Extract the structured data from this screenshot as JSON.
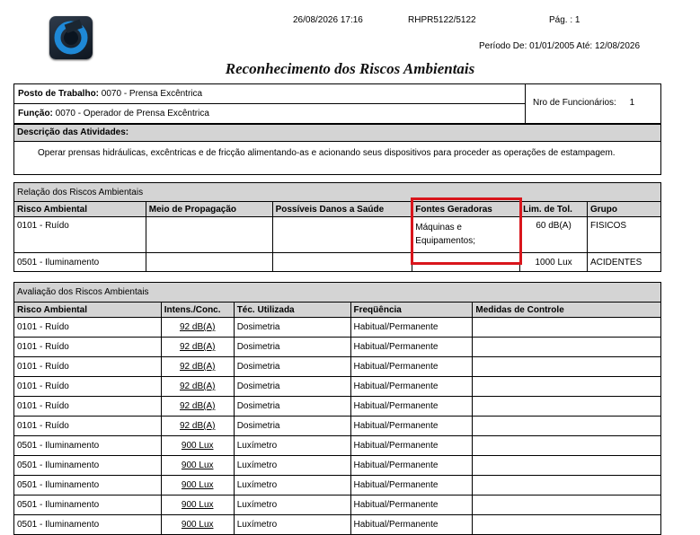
{
  "header": {
    "datetime": "26/08/2026 17:16",
    "report_code": "RHPR5122/5122",
    "page": "Pág. : 1",
    "period": "Período De: 01/01/2005 Até: 12/08/2026"
  },
  "title": "Reconhecimento dos Riscos Ambientais",
  "posto_label": "Posto de Trabalho:",
  "posto_value": "0070 - Prensa Excêntrica",
  "funcao_label": "Função:",
  "funcao_value": "0070 - Operador de Prensa Excêntrica",
  "nro_func_label": "Nro de Funcionários:",
  "nro_func_value": "1",
  "atividades_label": "Descrição das Atividades:",
  "atividades_text": "Operar prensas hidráulicas, excêntricas e de fricção alimentando-as e acionando seus dispositivos para proceder as operações de estampagem.",
  "relacao": {
    "section_title": "Relação dos Riscos Ambientais",
    "columns": [
      "Risco Ambiental",
      "Meio de Propagação",
      "Possíveis Danos a Saúde",
      "Fontes Geradoras",
      "Lim. de Tol.",
      "Grupo"
    ],
    "rows": [
      {
        "risco": "0101 - Ruído",
        "meio": "",
        "danos": "",
        "fontes": "Máquinas e Equipamentos;",
        "lim": "60 dB(A)",
        "grupo": "FISICOS"
      },
      {
        "risco": "0501 - Iluminamento",
        "meio": "",
        "danos": "",
        "fontes": "",
        "lim": "1000 Lux",
        "grupo": "ACIDENTES"
      }
    ]
  },
  "avaliacao": {
    "section_title": "Avaliação dos Riscos Ambientais",
    "columns": [
      "Risco Ambiental",
      "Intens./Conc.",
      "Téc. Utilizada",
      "Freqüência",
      "Medidas de Controle"
    ],
    "rows": [
      {
        "risco": "0101 - Ruído",
        "intens": "92 dB(A)",
        "tec": "Dosimetria",
        "freq": "Habitual/Permanente",
        "medidas": ""
      },
      {
        "risco": "0101 - Ruído",
        "intens": "92 dB(A)",
        "tec": "Dosimetria",
        "freq": "Habitual/Permanente",
        "medidas": ""
      },
      {
        "risco": "0101 - Ruído",
        "intens": "92 dB(A)",
        "tec": "Dosimetria",
        "freq": "Habitual/Permanente",
        "medidas": ""
      },
      {
        "risco": "0101 - Ruído",
        "intens": "92 dB(A)",
        "tec": "Dosimetria",
        "freq": "Habitual/Permanente",
        "medidas": ""
      },
      {
        "risco": "0101 - Ruído",
        "intens": "92 dB(A)",
        "tec": "Dosimetria",
        "freq": "Habitual/Permanente",
        "medidas": ""
      },
      {
        "risco": "0101 - Ruído",
        "intens": "92 dB(A)",
        "tec": "Dosimetria",
        "freq": "Habitual/Permanente",
        "medidas": ""
      },
      {
        "risco": "0501 - Iluminamento",
        "intens": "900 Lux",
        "tec": "Luxímetro",
        "freq": "Habitual/Permanente",
        "medidas": ""
      },
      {
        "risco": "0501 - Iluminamento",
        "intens": "900 Lux",
        "tec": "Luxímetro",
        "freq": "Habitual/Permanente",
        "medidas": ""
      },
      {
        "risco": "0501 - Iluminamento",
        "intens": "900 Lux",
        "tec": "Luxímetro",
        "freq": "Habitual/Permanente",
        "medidas": ""
      },
      {
        "risco": "0501 - Iluminamento",
        "intens": "900 Lux",
        "tec": "Luxímetro",
        "freq": "Habitual/Permanente",
        "medidas": ""
      },
      {
        "risco": "0501 - Iluminamento",
        "intens": "900 Lux",
        "tec": "Luxímetro",
        "freq": "Habitual/Permanente",
        "medidas": ""
      }
    ]
  },
  "colors": {
    "header_gray": "#d4d4d4",
    "highlight_red": "#d9151c"
  }
}
